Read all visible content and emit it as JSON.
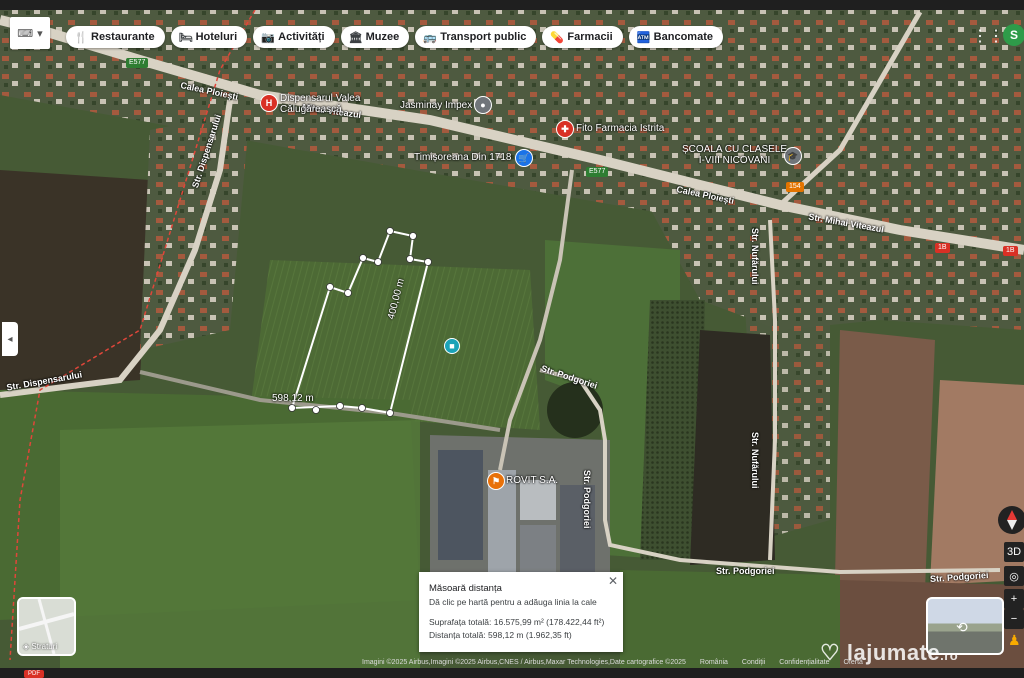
{
  "toolbar": {
    "keyboard_icon": "keyboard-icon",
    "categories": [
      {
        "label": "Restaurante",
        "icon": "fork-knife-icon",
        "glyph": "🍴"
      },
      {
        "label": "Hoteluri",
        "icon": "bed-icon",
        "glyph": "🛏"
      },
      {
        "label": "Activități",
        "icon": "camera-icon",
        "glyph": "📷"
      },
      {
        "label": "Muzee",
        "icon": "museum-icon",
        "glyph": "🏛"
      },
      {
        "label": "Transport public",
        "icon": "bus-icon",
        "glyph": "🚌"
      },
      {
        "label": "Farmacii",
        "icon": "pharmacy-icon",
        "glyph": "💊"
      },
      {
        "label": "Bancomate",
        "icon": "atm-icon",
        "glyph": "🏧"
      }
    ],
    "avatar_letter": "S"
  },
  "places": {
    "dispensar": "Dispensarul Valea Călugărească",
    "jasminay": "Jasminay Impex",
    "fito": "Fito Farmacia Istrita",
    "timisoreana": "Timișoreana Din 1718",
    "scoala_line1": "ȘCOALA CU CLASELE",
    "scoala_line2": "I-VIII NICOVANI",
    "rovit": "ROVIT S.A."
  },
  "roads": {
    "calea_ploiesti": "Calea Ploiești",
    "mihai_viteazul": "Mihai Viteazul",
    "str_mihai_viteazul": "Str. Mihai Viteazul",
    "str_dispensarului": "Str. Dispensarului",
    "str_podgoriei": "Str. Podgoriei",
    "str_nufarului": "Str. Nufărului",
    "e577": "E577",
    "r154": "154",
    "r1b": "1B"
  },
  "measurement": {
    "segment_length": "400,00 m",
    "path_length": "598,12 m",
    "panel": {
      "title": "Măsoară distanța",
      "subtitle": "Dă clic pe hartă pentru a adăuga linia la cale",
      "area": "Suprafața totală: 16.575,99 m² (178.422,44 ft²)",
      "distance": "Distanța totală: 598,12 m (1.962,35 ft)"
    }
  },
  "layers_label": "Straturi",
  "controls": {
    "view_3d": "3D"
  },
  "footer": {
    "attribution": "Imagini ©2025 Airbus,Imagini ©2025 Airbus,CNES / Airbus,Maxar Technologies,Date cartografice ©2025",
    "country": "România",
    "terms": "Condiții",
    "privacy": "Confidențialitate",
    "offer": "Ofertă"
  },
  "watermark": {
    "brand": "lajumate",
    "tld": ".ro"
  },
  "colors": {
    "field_dark": "#3b4a2c",
    "field_light": "#4f6b36",
    "road": "#d8d2c4",
    "measure_line": "#ffffff",
    "pin_red": "#d93025",
    "pin_blue": "#1a73e8",
    "pin_grey": "#70757a",
    "pin_orange": "#e8710a"
  }
}
